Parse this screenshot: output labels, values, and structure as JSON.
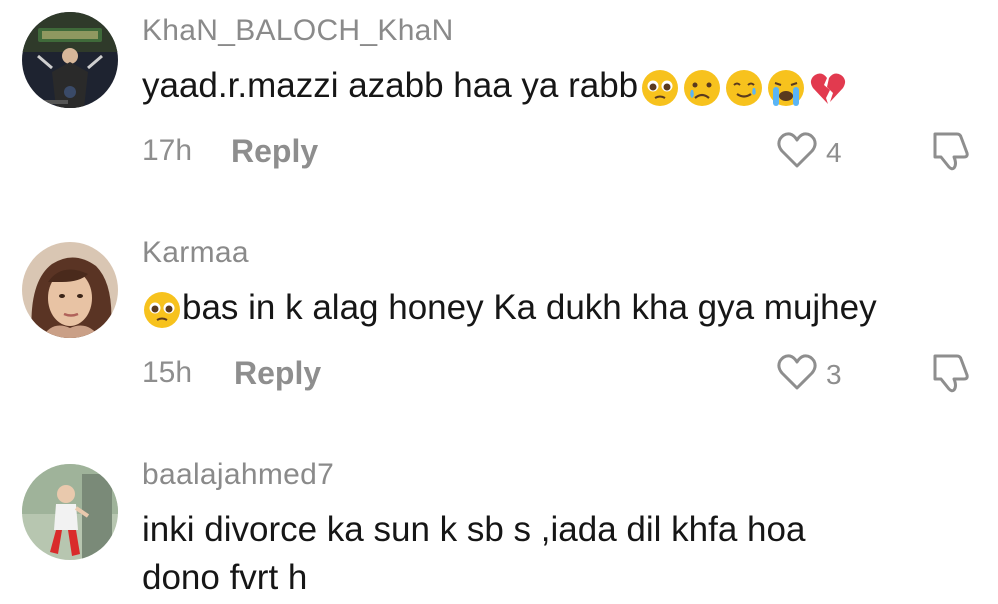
{
  "comments": [
    {
      "username": "KhaN_BALOCH_KhaN",
      "text": "yaad.r.mazzi azabb haa ya rabb",
      "emojis": [
        "pleading-face-icon",
        "sad-face-icon",
        "smiling-tear-face-icon",
        "crying-face-icon",
        "broken-heart-icon"
      ],
      "time": "17h",
      "reply_label": "Reply",
      "likes": "4"
    },
    {
      "username": "Karmaa",
      "text_emoji": "pleading-face-icon",
      "text": "bas in k alag honey Ka dukh kha gya mujhey",
      "time": "15h",
      "reply_label": "Reply",
      "likes": "3"
    },
    {
      "username": "baalajahmed7",
      "text_line1": "inki divorce ka sun k sb s ,iada dil khfa hoa",
      "text_line2": "dono fvrt h"
    }
  ],
  "colors": {
    "username": "#8a8a8a",
    "text": "#161616",
    "meta": "#8e8e8e",
    "emoji_yellow": "#f7c21d",
    "broken_heart": "#e23a4f"
  }
}
